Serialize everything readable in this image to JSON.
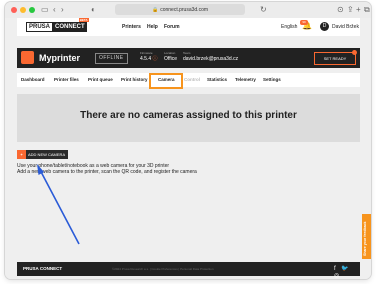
{
  "browser": {
    "url": "connect.prusa3d.com",
    "lock_icon": "lock-icon"
  },
  "topnav": {
    "logo_left": "PRUSA",
    "logo_right": "CONNECT",
    "logo_badge": "BETA",
    "links": [
      "Printers",
      "Help",
      "Forum"
    ],
    "language": "English",
    "notifications_count": "99",
    "user_initials": "D",
    "username": "David Bržek"
  },
  "printer": {
    "name": "Myprinter",
    "status": "OFFLINE",
    "firmware_label": "Firmware",
    "firmware_value": "4.5.4",
    "location_label": "Location",
    "location_value": "Office",
    "team_label": "Team",
    "team_value": "david.brzek@prusa3d.cz",
    "set_ready_label": "SET READY"
  },
  "tabs": {
    "dashboard": "Dashboard",
    "files": "Printer files",
    "queue": "Print queue",
    "history": "Print history",
    "cameras": "Camera",
    "control": "Control",
    "statistics": "Statistics",
    "telemetry": "Telemetry",
    "settings": "Settings"
  },
  "main": {
    "empty_message": "There are no cameras assigned to this printer",
    "add_button_label": "ADD NEW CAMERA",
    "desc_line1": "Use your phone/tablet/notebook as a web camera for your 3D printer",
    "desc_line2": "Add a new web camera to the printer, scan the QR code, and register the camera"
  },
  "feedback_label": "Share your feedback",
  "footer": {
    "brand": "PRUSA CONNECT",
    "copyright": "©2024 Prusa Research a.s. | Cookie Preferences | Personal Data Protection",
    "social": [
      "f",
      "t",
      "ig"
    ]
  },
  "colors": {
    "accent": "#fa6831",
    "highlight": "#f7941d",
    "dark": "#222222",
    "arrow": "#2a5bd7"
  }
}
